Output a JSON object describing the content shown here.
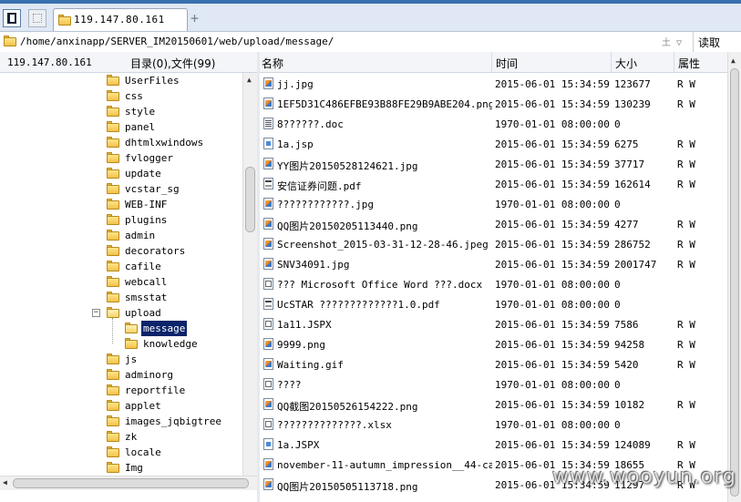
{
  "tabs": [
    {
      "label": "119.147.80.161",
      "active": true
    }
  ],
  "address": {
    "path": "/home/anxinapp/SERVER_IM20150601/web/upload/message/",
    "read_button": "读取",
    "sort_glyph": "土 ▽"
  },
  "left_pane": {
    "host": "119.147.80.161",
    "summary": "目录(0),文件(99)"
  },
  "tree": [
    {
      "label": "UserFiles",
      "depth": 0,
      "open": false,
      "selected": false
    },
    {
      "label": "css",
      "depth": 0,
      "open": false,
      "selected": false
    },
    {
      "label": "style",
      "depth": 0,
      "open": false,
      "selected": false
    },
    {
      "label": "panel",
      "depth": 0,
      "open": false,
      "selected": false
    },
    {
      "label": "dhtmlxwindows",
      "depth": 0,
      "open": false,
      "selected": false
    },
    {
      "label": "fvlogger",
      "depth": 0,
      "open": false,
      "selected": false
    },
    {
      "label": "update",
      "depth": 0,
      "open": false,
      "selected": false
    },
    {
      "label": "vcstar_sg",
      "depth": 0,
      "open": false,
      "selected": false
    },
    {
      "label": "WEB-INF",
      "depth": 0,
      "open": false,
      "selected": false
    },
    {
      "label": "plugins",
      "depth": 0,
      "open": false,
      "selected": false
    },
    {
      "label": "admin",
      "depth": 0,
      "open": false,
      "selected": false
    },
    {
      "label": "decorators",
      "depth": 0,
      "open": false,
      "selected": false
    },
    {
      "label": "cafile",
      "depth": 0,
      "open": false,
      "selected": false
    },
    {
      "label": "webcall",
      "depth": 0,
      "open": false,
      "selected": false
    },
    {
      "label": "smsstat",
      "depth": 0,
      "open": false,
      "selected": false
    },
    {
      "label": "upload",
      "depth": 0,
      "open": true,
      "selected": false,
      "expander": "−"
    },
    {
      "label": "message",
      "depth": 1,
      "open": true,
      "selected": true
    },
    {
      "label": "knowledge",
      "depth": 1,
      "open": false,
      "selected": false
    },
    {
      "label": "js",
      "depth": 0,
      "open": false,
      "selected": false
    },
    {
      "label": "adminorg",
      "depth": 0,
      "open": false,
      "selected": false
    },
    {
      "label": "reportfile",
      "depth": 0,
      "open": false,
      "selected": false
    },
    {
      "label": "applet",
      "depth": 0,
      "open": false,
      "selected": false
    },
    {
      "label": "images_jqbigtree",
      "depth": 0,
      "open": false,
      "selected": false
    },
    {
      "label": "zk",
      "depth": 0,
      "open": false,
      "selected": false
    },
    {
      "label": "locale",
      "depth": 0,
      "open": false,
      "selected": false
    },
    {
      "label": "Img",
      "depth": 0,
      "open": false,
      "selected": false
    }
  ],
  "columns": {
    "name": "名称",
    "time": "时间",
    "size": "大小",
    "attr": "属性"
  },
  "files": [
    {
      "name": "jj.jpg",
      "time": "2015-06-01 15:34:59",
      "size": "123677",
      "attr": "R W",
      "icon": "img"
    },
    {
      "name": "1EF5D31C486EFBE93B88FE29B9ABE204.png",
      "time": "2015-06-01 15:34:59",
      "size": "130239",
      "attr": "R W",
      "icon": "img"
    },
    {
      "name": "8??????.doc",
      "time": "1970-01-01 08:00:00",
      "size": "0",
      "attr": "",
      "icon": "doc"
    },
    {
      "name": "1a.jsp",
      "time": "2015-06-01 15:34:59",
      "size": "6275",
      "attr": "R W",
      "icon": "jsp"
    },
    {
      "name": "YY图片20150528124621.jpg",
      "time": "2015-06-01 15:34:59",
      "size": "37717",
      "attr": "R W",
      "icon": "img"
    },
    {
      "name": "安信证券问题.pdf",
      "time": "2015-06-01 15:34:59",
      "size": "162614",
      "attr": "R W",
      "icon": "pdf"
    },
    {
      "name": "????????????.jpg",
      "time": "1970-01-01 08:00:00",
      "size": "0",
      "attr": "",
      "icon": "img"
    },
    {
      "name": "QQ图片20150205113440.png",
      "time": "2015-06-01 15:34:59",
      "size": "4277",
      "attr": "R W",
      "icon": "img"
    },
    {
      "name": "Screenshot_2015-03-31-12-28-46.jpeg",
      "time": "2015-06-01 15:34:59",
      "size": "286752",
      "attr": "R W",
      "icon": "img"
    },
    {
      "name": "SNV34091.jpg",
      "time": "2015-06-01 15:34:59",
      "size": "2001747",
      "attr": "R W",
      "icon": "img"
    },
    {
      "name": "??? Microsoft Office Word ???.docx",
      "time": "1970-01-01 08:00:00",
      "size": "0",
      "attr": "",
      "icon": "bin"
    },
    {
      "name": "UcSTAR ?????????????1.0.pdf",
      "time": "1970-01-01 08:00:00",
      "size": "0",
      "attr": "",
      "icon": "pdf"
    },
    {
      "name": "1a11.JSPX",
      "time": "2015-06-01 15:34:59",
      "size": "7586",
      "attr": "R W",
      "icon": "bin"
    },
    {
      "name": "9999.png",
      "time": "2015-06-01 15:34:59",
      "size": "94258",
      "attr": "R W",
      "icon": "img"
    },
    {
      "name": "Waiting.gif",
      "time": "2015-06-01 15:34:59",
      "size": "5420",
      "attr": "R W",
      "icon": "img"
    },
    {
      "name": "????",
      "time": "1970-01-01 08:00:00",
      "size": "0",
      "attr": "",
      "icon": "bin"
    },
    {
      "name": "QQ截图20150526154222.png",
      "time": "2015-06-01 15:34:59",
      "size": "10182",
      "attr": "R W",
      "icon": "img"
    },
    {
      "name": "??????????????.xlsx",
      "time": "1970-01-01 08:00:00",
      "size": "0",
      "attr": "",
      "icon": "bin"
    },
    {
      "name": "1a.JSPX",
      "time": "2015-06-01 15:34:59",
      "size": "124089",
      "attr": "R W",
      "icon": "jsp"
    },
    {
      "name": "november-11-autumn_impression__44-ca...",
      "time": "2015-06-01 15:34:59",
      "size": "18655",
      "attr": "R W",
      "icon": "img"
    },
    {
      "name": "QQ图片20150505113718.png",
      "time": "2015-06-01 15:34:59",
      "size": "11297",
      "attr": "R W",
      "icon": "img"
    }
  ],
  "watermark": "www.wooyun.org"
}
